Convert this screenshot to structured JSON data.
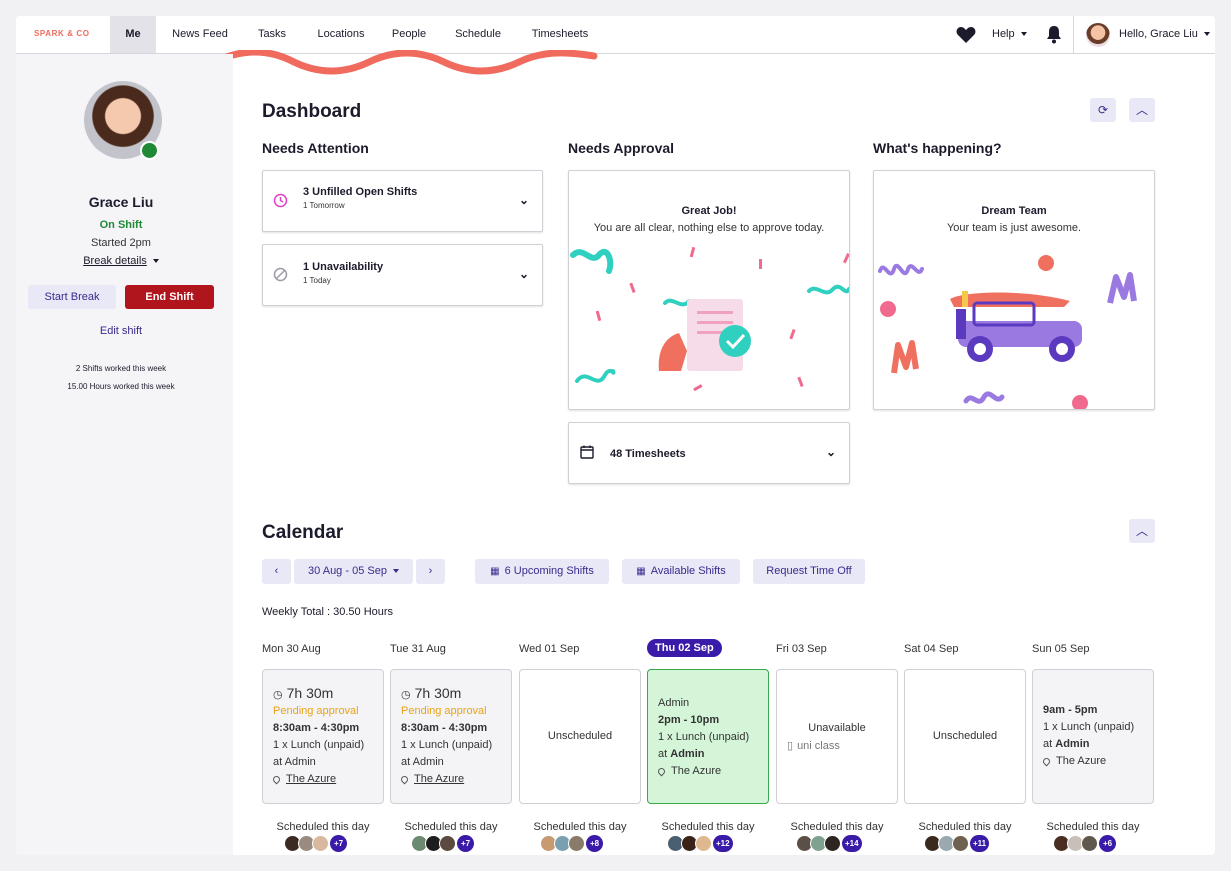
{
  "nav": {
    "logo": "SPARK & CO",
    "items": [
      {
        "label": "Me",
        "active": true
      },
      {
        "label": "News Feed"
      },
      {
        "label": "Tasks"
      },
      {
        "label": "Locations"
      },
      {
        "label": "People"
      },
      {
        "label": "Schedule"
      },
      {
        "label": "Timesheets"
      }
    ],
    "help_label": "Help",
    "user_greeting": "Hello, Grace Liu",
    "icons": [
      "heart-icon",
      "bell-icon"
    ]
  },
  "profile": {
    "name": "Grace Liu",
    "status": "On Shift",
    "status_color": "#1f8a36",
    "started": "Started 2pm",
    "break_details": "Break details",
    "start_break": "Start Break",
    "end_shift": "End Shift",
    "edit_shift": "Edit shift",
    "shifts_week": "2 Shifts worked this week",
    "hours_week": "15.00 Hours worked this week"
  },
  "dashboard": {
    "title": "Dashboard",
    "needs_attention": {
      "heading": "Needs Attention",
      "items": [
        {
          "title": "3 Unfilled Open Shifts",
          "sub": "1 Tomorrow",
          "icon": "clock-icon"
        },
        {
          "title": "1 Unavailability",
          "sub": "1 Today",
          "icon": "unavailable-icon"
        }
      ]
    },
    "needs_approval": {
      "heading": "Needs Approval",
      "card_title": "Great Job!",
      "card_text": "You are all clear, nothing else to approve today.",
      "timesheets": "48 Timesheets"
    },
    "whats_happening": {
      "heading": "What's happening?",
      "card_title": "Dream Team",
      "card_text": "Your team is just awesome."
    }
  },
  "calendar": {
    "title": "Calendar",
    "range": "30 Aug - 05 Sep",
    "upcoming": "6 Upcoming Shifts",
    "available": "Available Shifts",
    "request_off": "Request Time Off",
    "weekly_total": "Weekly Total : 30.50 Hours",
    "scheduled_label": "Scheduled this day",
    "days": [
      {
        "label": "Mon 30 Aug",
        "duration": "7h 30m",
        "pending": "Pending approval",
        "time": "8:30am - 4:30pm",
        "break": "1 x Lunch (unpaid)",
        "at": "at Admin",
        "location": "The Azure",
        "more": "+7"
      },
      {
        "label": "Tue 31 Aug",
        "duration": "7h 30m",
        "pending": "Pending approval",
        "time": "8:30am - 4:30pm",
        "break": "1 x Lunch (unpaid)",
        "at": "at Admin",
        "location": "The Azure",
        "more": "+7"
      },
      {
        "label": "Wed 01 Sep",
        "text": "Unscheduled",
        "more": "+8"
      },
      {
        "label": "Thu 02 Sep",
        "role": "Admin",
        "time": "2pm - 10pm",
        "break": "1 x Lunch (unpaid)",
        "at_prefix": "at",
        "at_bold": "Admin",
        "location": "The Azure",
        "more": "+12"
      },
      {
        "label": "Fri 03 Sep",
        "text": "Unavailable",
        "note": "uni class",
        "more": "+14"
      },
      {
        "label": "Sat 04 Sep",
        "text": "Unscheduled",
        "more": "+11"
      },
      {
        "label": "Sun 05 Sep",
        "time": "9am - 5pm",
        "break": "1 x Lunch (unpaid)",
        "at_prefix": "at",
        "at_bold": "Admin",
        "location": "The Azure",
        "more": "+6"
      }
    ]
  },
  "colors": {
    "accent": "#3a1aa8",
    "pending": "#e8a317",
    "end_shift": "#b0141c"
  }
}
